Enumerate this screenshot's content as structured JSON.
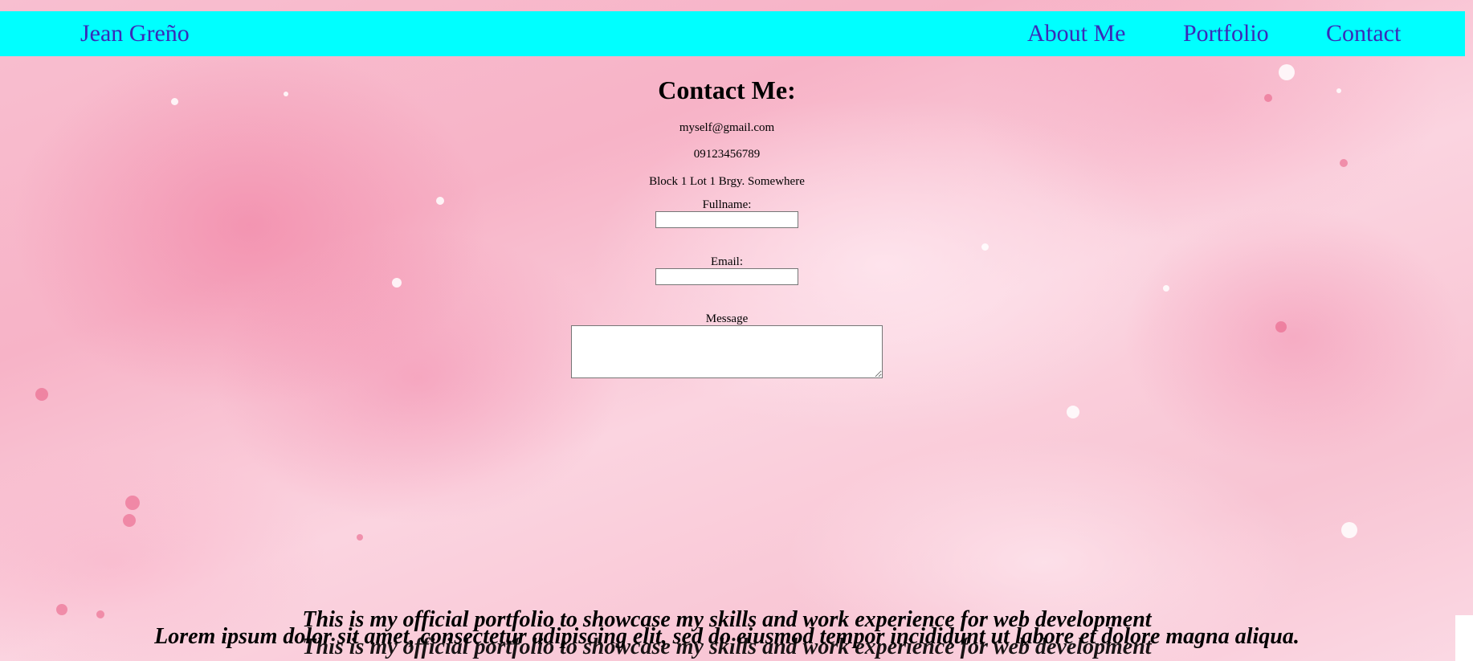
{
  "nav": {
    "brand": "Jean Greño",
    "links": [
      "About Me",
      "Portfolio",
      "Contact"
    ]
  },
  "contact": {
    "heading": "Contact Me:",
    "email": "myself@gmail.com",
    "phone": "09123456789",
    "address": "Block 1 Lot 1 Brgy. Somewhere",
    "form": {
      "fullname_label": "Fullname:",
      "fullname_value": "",
      "email_label": "Email:",
      "email_value": "",
      "message_label": "Message",
      "message_value": ""
    }
  },
  "footer": {
    "tagline": "This is my official portfolio to showcase my skills and work experience for web development",
    "lorem": "Lorem ipsum dolor sit amet, consectetur adipiscing elit, sed do eiusmod tempor incididunt ut labore et dolore magna aliqua."
  },
  "colors": {
    "navbar_bg": "#00ffff",
    "nav_text": "#3a2bb8",
    "page_bg": "#f8bfd0"
  }
}
